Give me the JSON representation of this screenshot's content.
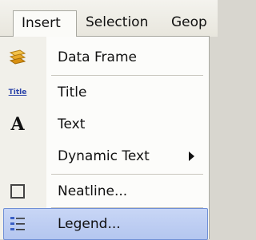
{
  "menubar": {
    "items": [
      {
        "label": "Insert"
      },
      {
        "label": "Selection"
      },
      {
        "label": "Geop"
      }
    ]
  },
  "dropdown": {
    "items": [
      {
        "label": "Data Frame",
        "icon": "data-frame-icon"
      },
      {
        "label": "Title",
        "icon": "title-icon",
        "icon_text": "Title"
      },
      {
        "label": "Text",
        "icon": "text-icon",
        "icon_text": "A"
      },
      {
        "label": "Dynamic Text",
        "icon": "submenu-arrow-icon"
      },
      {
        "label": "Neatline...",
        "icon": "neatline-icon"
      },
      {
        "label": "Legend...",
        "icon": "legend-icon"
      }
    ]
  },
  "colors": {
    "highlight": "#c8d6f6",
    "highlight_border": "#6f8fd6",
    "data_frame_icon": "#e0a020",
    "legend_icon": "#3a5fc4"
  }
}
